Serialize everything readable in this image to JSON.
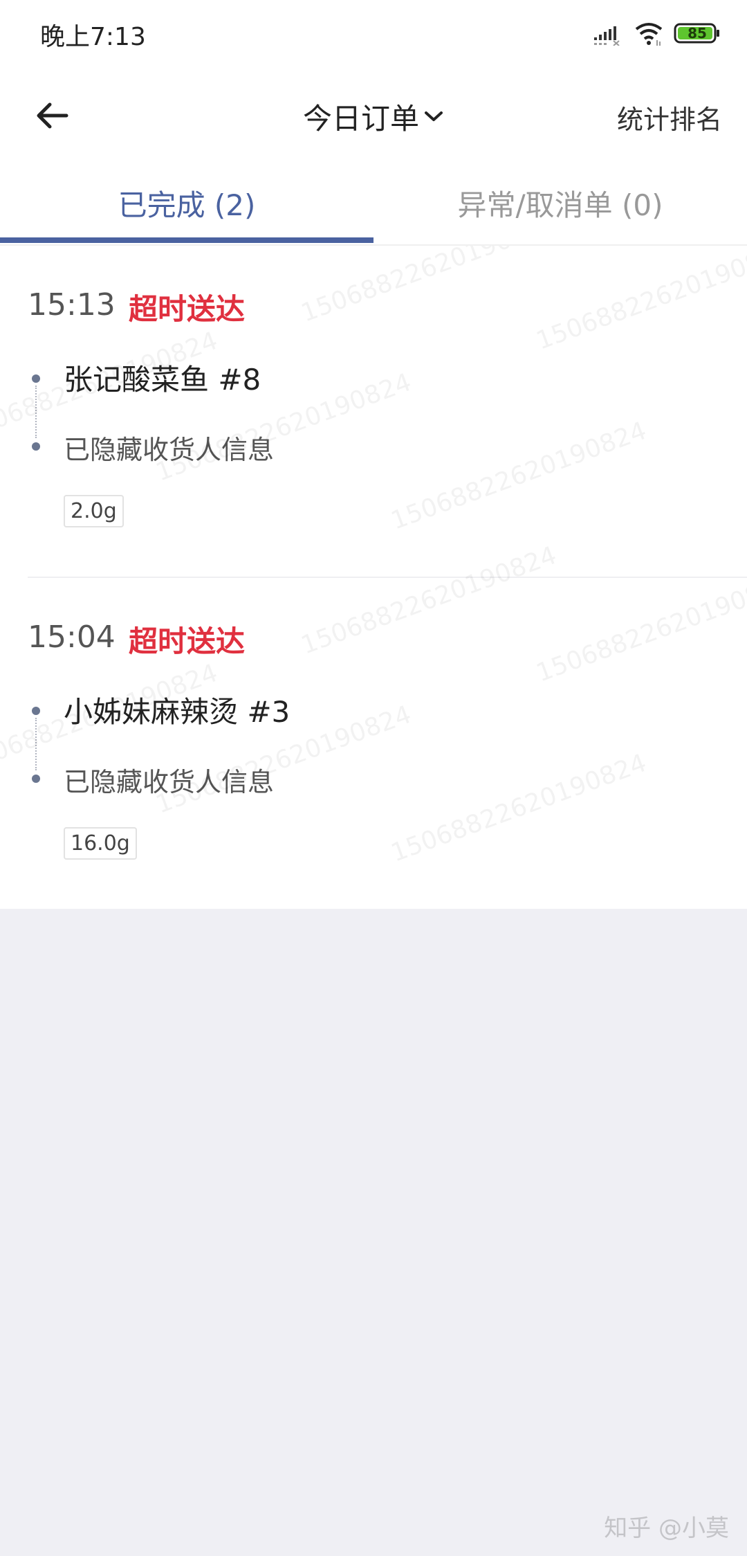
{
  "status_bar": {
    "time": "晚上7:13",
    "battery": "85"
  },
  "header": {
    "title": "今日订单",
    "right_action": "统计排名"
  },
  "tabs": [
    {
      "label": "已完成 (2)",
      "active": true
    },
    {
      "label": "异常/取消单 (0)",
      "active": false
    }
  ],
  "orders": [
    {
      "time": "15:13",
      "status": "超时送达",
      "merchant": "张记酸菜鱼 #8",
      "customer": "已隐藏收货人信息",
      "weight": "2.0g"
    },
    {
      "time": "15:04",
      "status": "超时送达",
      "merchant": "小姊妹麻辣烫 #3",
      "customer": "已隐藏收货人信息",
      "weight": "16.0g"
    }
  ],
  "watermark_text": "15068822620190824",
  "footer_watermark": "知乎 @小莫",
  "colors": {
    "accent": "#4a62a0",
    "status_red": "#e0303f",
    "background": "#efeff4"
  }
}
